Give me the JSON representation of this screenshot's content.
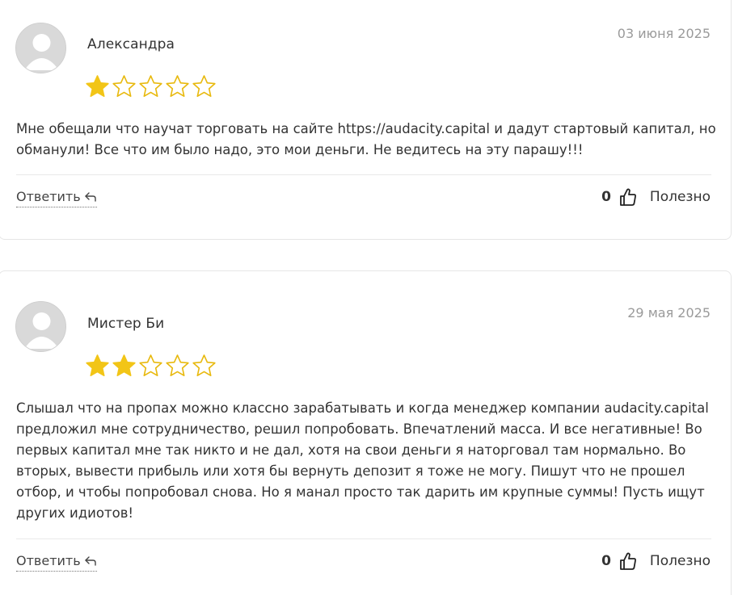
{
  "reviews": [
    {
      "author": "Александра",
      "date": "03 июня 2025",
      "rating": 1,
      "rating_max": 5,
      "text": "Мне обещали что научат торговать на сайте https://audacity.capital и дадут стартовый капитал, но обманули! Все что им было надо, это мои деньги. Не ведитесь на эту парашу!!!",
      "reply_label": "Ответить",
      "helpful_count": "0",
      "helpful_label": "Полезно"
    },
    {
      "author": "Мистер Би",
      "date": "29 мая 2025",
      "rating": 2,
      "rating_max": 5,
      "text": "Слышал что на пропах можно классно зарабатывать и когда менеджер компании audacity.capital предложил мне сотрудничество, решил попробовать. Впечатлений масса. И все негативные! Во первых капитал мне так никто и не дал, хотя на свои деньги я наторговал там нормально. Во вторых, вывести прибыль или хотя бы вернуть депозит я тоже не могу. Пишут что не прошел отбор, и чтобы попробовал снова. Но я манал просто так дарить им крупные суммы! Пусть ищут других идиотов!",
      "reply_label": "Ответить",
      "helpful_count": "0",
      "helpful_label": "Полезно"
    }
  ],
  "colors": {
    "star_filled": "#F2C517",
    "star_outline": "#E8B90E",
    "date": "#9A9A9A",
    "avatar_bg": "#D9D9D9"
  },
  "icons": {
    "avatar": "user-silhouette-icon",
    "star": "star-icon",
    "reply": "reply-arrow-icon",
    "helpful": "thumbs-up-icon"
  }
}
